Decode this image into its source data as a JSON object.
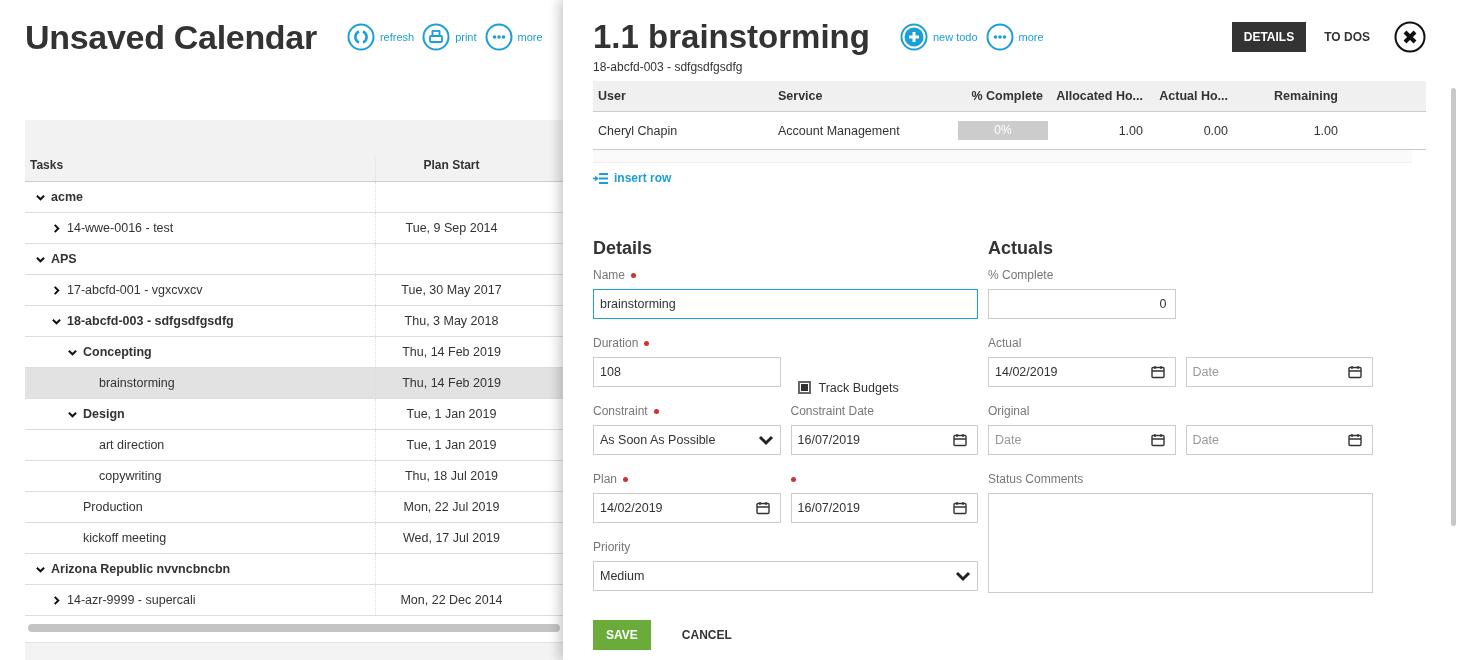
{
  "calendar": {
    "title": "Unsaved Calendar",
    "actions": [
      {
        "kind": "refresh",
        "label": "refresh"
      },
      {
        "kind": "print",
        "label": "print"
      },
      {
        "kind": "more",
        "label": "more"
      }
    ],
    "table": {
      "columns": [
        "Tasks",
        "Plan Start"
      ],
      "rows": [
        {
          "label": "acme",
          "expanded": true,
          "selected": false,
          "children": [
            {
              "label": "14-wwe-0016 - test",
              "plan_start": "Tue, 9 Sep 2014",
              "expanded": false,
              "selected": false
            }
          ]
        },
        {
          "label": "APS",
          "expanded": true,
          "selected": false,
          "children": [
            {
              "label": "17-abcfd-001 - vgxcvxcv",
              "plan_start": "Tue, 30 May 2017",
              "expanded": false,
              "selected": false
            },
            {
              "label": "18-abcfd-003 - sdfgsdfgsdfg",
              "plan_start": "Thu, 3 May 2018",
              "expanded": true,
              "selected": false,
              "children": [
                {
                  "label": "Concepting",
                  "plan_start": "Thu, 14 Feb 2019",
                  "expanded": true,
                  "selected": false,
                  "children": [
                    {
                      "label": "brainstorming",
                      "plan_start": "Thu, 14 Feb 2019",
                      "selected": true
                    }
                  ]
                },
                {
                  "label": "Design",
                  "plan_start": "Tue, 1 Jan 2019",
                  "expanded": true,
                  "selected": false,
                  "children": [
                    {
                      "label": "art direction",
                      "plan_start": "Tue, 1 Jan 2019",
                      "selected": false
                    },
                    {
                      "label": "copywriting",
                      "plan_start": "Thu, 18 Jul 2019",
                      "selected": false
                    }
                  ]
                },
                {
                  "label": "Production",
                  "plan_start": "Mon, 22 Jul 2019",
                  "selected": false
                },
                {
                  "label": "kickoff meeting",
                  "plan_start": "Wed, 17 Jul 2019",
                  "selected": false
                }
              ]
            }
          ]
        },
        {
          "label": "Arizona Republic nvvncbncbn",
          "expanded": true,
          "selected": false,
          "children": [
            {
              "label": "14-azr-9999 - supercali",
              "plan_start": "Mon, 22 Dec 2014",
              "expanded": false,
              "selected": false
            }
          ]
        }
      ]
    }
  },
  "drawer": {
    "title": "1.1 brainstorming",
    "subtitle": "18-abcfd-003 - sdfgsdfgsdfg",
    "actions": [
      {
        "kind": "add",
        "label": "new todo"
      },
      {
        "kind": "more",
        "label": "more"
      }
    ],
    "tabs": [
      {
        "label": "DETAILS",
        "selected": true
      },
      {
        "label": "TO DOS",
        "selected": false
      }
    ],
    "resources": {
      "columns": [
        "User",
        "Service",
        "% Complete",
        "Allocated Ho...",
        "Actual Ho...",
        "Remaining"
      ],
      "rows": [
        {
          "user": "Cheryl Chapin",
          "service": "Account Management",
          "complete": {
            "level": 0,
            "reading": "0%"
          },
          "allocated": "1.00",
          "actual": "0.00",
          "remaining": "1.00"
        }
      ]
    },
    "insert_row": "insert row",
    "details": {
      "heading": "Details",
      "rows": [
        [
          {
            "kind": "text",
            "label": "Name",
            "required": true,
            "value": "brainstorming",
            "focused": true
          }
        ],
        [
          {
            "kind": "text",
            "label": "Duration",
            "required": true,
            "value": "108",
            "focused": false
          },
          {
            "kind": "checkbox",
            "label": "Track Budgets",
            "checked": true
          }
        ],
        [
          {
            "kind": "select",
            "label": "Constraint",
            "required": true,
            "value": "As Soon As Possible"
          },
          {
            "kind": "date",
            "label": "Constraint Date",
            "value": "16/07/2019"
          }
        ],
        [
          {
            "kind": "date",
            "label": "Plan",
            "required": true,
            "value": "14/02/2019"
          },
          {
            "kind": "date",
            "required": true,
            "value": "16/07/2019"
          }
        ],
        [
          {
            "kind": "select",
            "label": "Priority",
            "value": "Medium"
          }
        ]
      ]
    },
    "actuals": {
      "heading": "Actuals",
      "rows": [
        [
          {
            "kind": "number",
            "label": "% Complete",
            "value": "0"
          }
        ],
        [
          {
            "kind": "date",
            "label": "Actual",
            "value": "14/02/2019"
          },
          {
            "kind": "date",
            "placeholder": "Date"
          }
        ],
        [
          {
            "kind": "date",
            "label": "Original",
            "placeholder": "Date"
          },
          {
            "kind": "date",
            "placeholder": "Date"
          }
        ],
        [
          {
            "kind": "textarea",
            "label": "Status Comments"
          }
        ]
      ]
    },
    "buttons": [
      {
        "kind": "primary",
        "label": "SAVE"
      },
      {
        "kind": "plain",
        "label": "CANCEL"
      }
    ]
  }
}
